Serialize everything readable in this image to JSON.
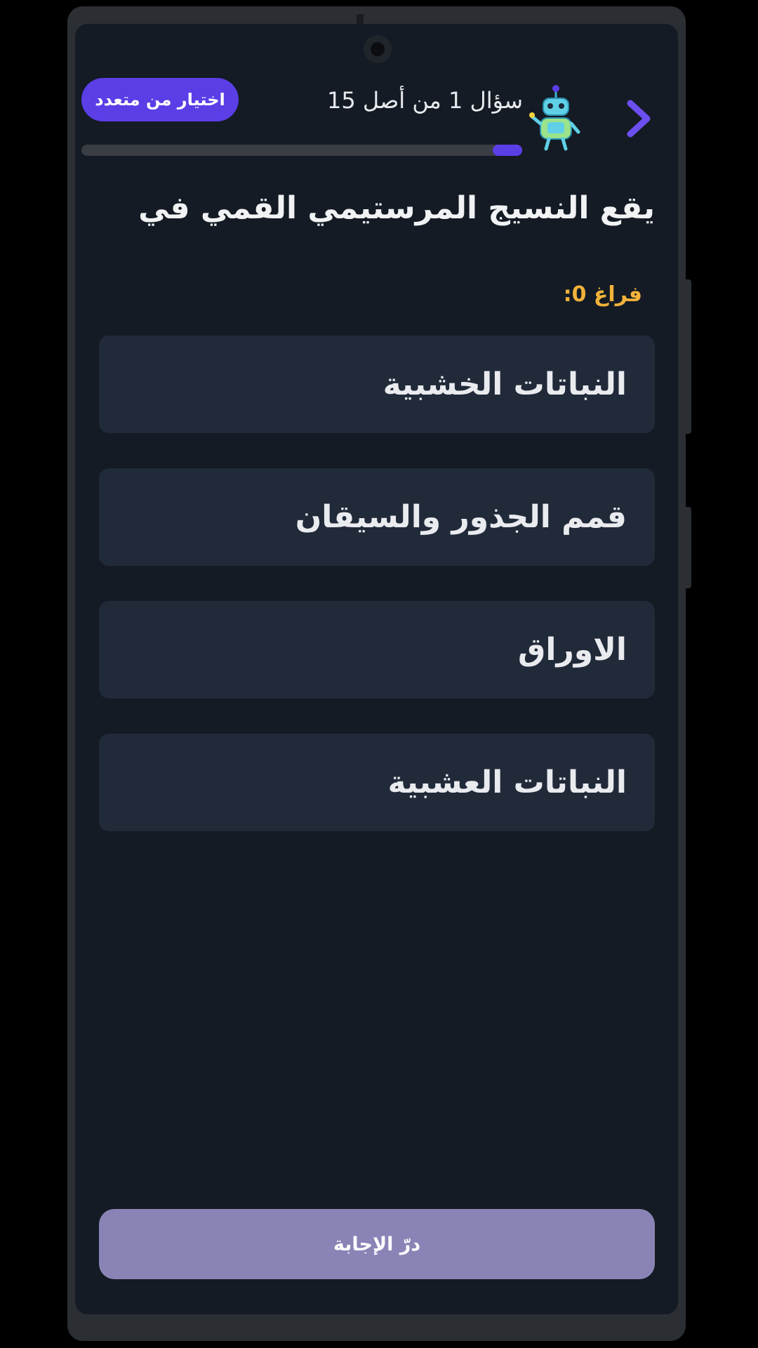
{
  "header": {
    "question_type_badge": "اختيار من متعدد",
    "question_counter": "سؤال 1 من أصل 15",
    "progress": 0.067,
    "mascot_icon": "robot-mascot-icon",
    "back_icon": "chevron-right-icon"
  },
  "question": {
    "text": "يقع النسيج المرستيمي القمي في",
    "blank_counter": "فراغ 0:"
  },
  "options": [
    {
      "label": "النباتات الخشبية"
    },
    {
      "label": "قمم الجذور والسيقان"
    },
    {
      "label": "الاوراق"
    },
    {
      "label": "النباتات العشبية"
    }
  ],
  "footer": {
    "submit_label": "درّ الإجابة"
  },
  "colors": {
    "background": "#141b24",
    "accent": "#5b3ee6",
    "option_bg": "#212a39",
    "blank_counter": "#f2b23a",
    "submit_bg": "#8a84b6"
  }
}
